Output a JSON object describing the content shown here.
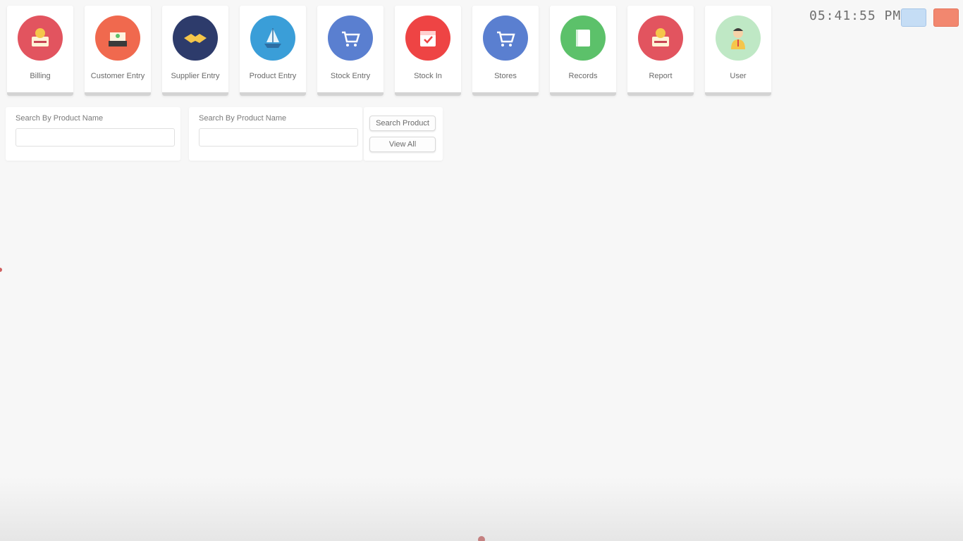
{
  "toolbar": {
    "tiles": [
      {
        "label": "Billing",
        "icon": "billing-icon",
        "color": "#e2545f"
      },
      {
        "label": "Customer Entry",
        "icon": "customer-icon",
        "color": "#f0694e"
      },
      {
        "label": "Supplier Entry",
        "icon": "handshake-icon",
        "color": "#2d3b6b"
      },
      {
        "label": "Product Entry",
        "icon": "ship-icon",
        "color": "#3a9ed8"
      },
      {
        "label": "Stock Entry",
        "icon": "cart-icon",
        "color": "#5a7fd0"
      },
      {
        "label": "Stock In",
        "icon": "calendar-icon",
        "color": "#ee4444"
      },
      {
        "label": "Stores",
        "icon": "cart-icon",
        "color": "#5a7fd0"
      },
      {
        "label": "Records",
        "icon": "book-icon",
        "color": "#5cc16a"
      },
      {
        "label": "Report",
        "icon": "report-icon",
        "color": "#e2545f"
      },
      {
        "label": "User",
        "icon": "user-icon",
        "color": "#8fd49a"
      }
    ]
  },
  "header": {
    "clock": "05:41:55 PM"
  },
  "search": {
    "left_label": "Search By Product Name",
    "right_label": "Search By Product Name",
    "left_value": "",
    "right_value": "",
    "search_button": "Search Product",
    "view_button": "View All"
  }
}
